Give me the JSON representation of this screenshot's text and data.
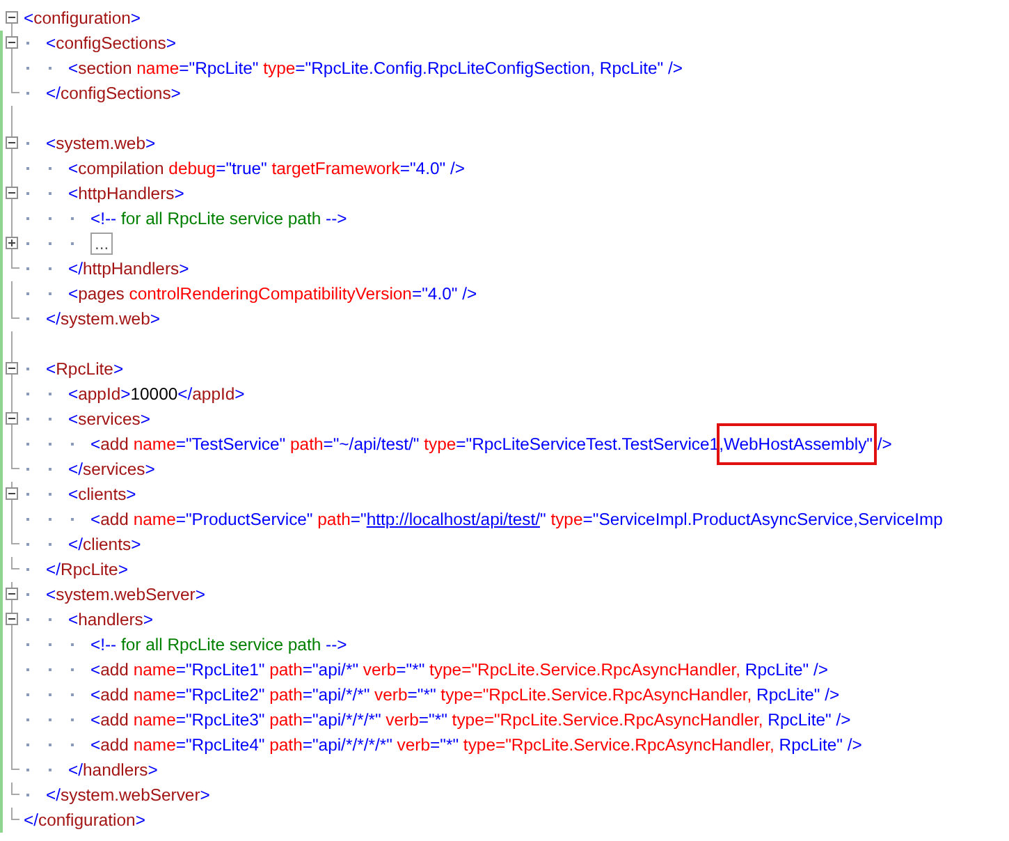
{
  "lines": [
    {
      "kind": "line",
      "expanded": true,
      "tokens": [
        {
          "kind": "d",
          "text": "<"
        },
        {
          "kind": "tag",
          "text": "configuration"
        },
        {
          "kind": "d",
          "text": ">"
        }
      ],
      "close": [
        {
          "kind": "d",
          "text": "</"
        },
        {
          "kind": "tag",
          "text": "configuration"
        },
        {
          "kind": "d",
          "text": ">"
        }
      ],
      "children": [
        {
          "kind": "line",
          "expanded": true,
          "tokens": [
            {
              "kind": "d",
              "text": "<"
            },
            {
              "kind": "tag",
              "text": "configSections"
            },
            {
              "kind": "d",
              "text": ">"
            }
          ],
          "close": [
            {
              "kind": "d",
              "text": "</"
            },
            {
              "kind": "tag",
              "text": "configSections"
            },
            {
              "kind": "d",
              "text": ">"
            }
          ],
          "children": [
            {
              "kind": "line",
              "tokens": [
                {
                  "kind": "d",
                  "text": "<"
                },
                {
                  "kind": "tag",
                  "text": "section"
                },
                {
                  "kind": "attr",
                  "text": " name"
                },
                {
                  "kind": "d",
                  "text": "="
                },
                {
                  "kind": "val",
                  "text": "\"RpcLite\""
                },
                {
                  "kind": "attr",
                  "text": " type"
                },
                {
                  "kind": "d",
                  "text": "="
                },
                {
                  "kind": "val",
                  "text": "\"RpcLite.Config.RpcLiteConfigSection, RpcLite\""
                },
                {
                  "kind": "d",
                  "text": " />"
                }
              ]
            }
          ]
        },
        {
          "kind": "blank"
        },
        {
          "kind": "line",
          "expanded": true,
          "tokens": [
            {
              "kind": "d",
              "text": "<"
            },
            {
              "kind": "tag",
              "text": "system.web"
            },
            {
              "kind": "d",
              "text": ">"
            }
          ],
          "close": [
            {
              "kind": "d",
              "text": "</"
            },
            {
              "kind": "tag",
              "text": "system.web"
            },
            {
              "kind": "d",
              "text": ">"
            }
          ],
          "children": [
            {
              "kind": "line",
              "tokens": [
                {
                  "kind": "d",
                  "text": "<"
                },
                {
                  "kind": "tag",
                  "text": "compilation"
                },
                {
                  "kind": "attr",
                  "text": " debug"
                },
                {
                  "kind": "d",
                  "text": "="
                },
                {
                  "kind": "val",
                  "text": "\"true\""
                },
                {
                  "kind": "attr",
                  "text": " targetFramework"
                },
                {
                  "kind": "d",
                  "text": "="
                },
                {
                  "kind": "val",
                  "text": "\"4.0\""
                },
                {
                  "kind": "d",
                  "text": " />"
                }
              ]
            },
            {
              "kind": "line",
              "expanded": true,
              "tokens": [
                {
                  "kind": "d",
                  "text": "<"
                },
                {
                  "kind": "tag",
                  "text": "httpHandlers"
                },
                {
                  "kind": "d",
                  "text": ">"
                }
              ],
              "close": [
                {
                  "kind": "d",
                  "text": "</"
                },
                {
                  "kind": "tag",
                  "text": "httpHandlers"
                },
                {
                  "kind": "d",
                  "text": ">"
                }
              ],
              "children": [
                {
                  "kind": "line",
                  "tokens": [
                    {
                      "kind": "d",
                      "text": "<!--"
                    },
                    {
                      "kind": "comment",
                      "text": " for all RpcLite service path "
                    },
                    {
                      "kind": "d",
                      "text": "-->"
                    }
                  ]
                },
                {
                  "kind": "collapsed",
                  "expanded": false,
                  "text": "..."
                }
              ]
            },
            {
              "kind": "line",
              "tokens": [
                {
                  "kind": "d",
                  "text": "<"
                },
                {
                  "kind": "tag",
                  "text": "pages"
                },
                {
                  "kind": "attr",
                  "text": " controlRenderingCompatibilityVersion"
                },
                {
                  "kind": "d",
                  "text": "="
                },
                {
                  "kind": "val",
                  "text": "\"4.0\""
                },
                {
                  "kind": "d",
                  "text": " />"
                }
              ]
            }
          ]
        },
        {
          "kind": "blank"
        },
        {
          "kind": "line",
          "expanded": true,
          "tokens": [
            {
              "kind": "d",
              "text": "<"
            },
            {
              "kind": "tag",
              "text": "RpcLite"
            },
            {
              "kind": "d",
              "text": ">"
            }
          ],
          "close": [
            {
              "kind": "d",
              "text": "</"
            },
            {
              "kind": "tag",
              "text": "RpcLite"
            },
            {
              "kind": "d",
              "text": ">"
            }
          ],
          "children": [
            {
              "kind": "line",
              "tokens": [
                {
                  "kind": "d",
                  "text": "<"
                },
                {
                  "kind": "tag",
                  "text": "appId"
                },
                {
                  "kind": "d",
                  "text": ">"
                },
                {
                  "kind": "text",
                  "text": "10000"
                },
                {
                  "kind": "d",
                  "text": "</"
                },
                {
                  "kind": "tag",
                  "text": "appId"
                },
                {
                  "kind": "d",
                  "text": ">"
                }
              ]
            },
            {
              "kind": "line",
              "expanded": true,
              "tokens": [
                {
                  "kind": "d",
                  "text": "<"
                },
                {
                  "kind": "tag",
                  "text": "services"
                },
                {
                  "kind": "d",
                  "text": ">"
                }
              ],
              "close": [
                {
                  "kind": "d",
                  "text": "</"
                },
                {
                  "kind": "tag",
                  "text": "services"
                },
                {
                  "kind": "d",
                  "text": ">"
                }
              ],
              "children": [
                {
                  "kind": "line",
                  "tokens": [
                    {
                      "kind": "d",
                      "text": "<"
                    },
                    {
                      "kind": "tag",
                      "text": "add"
                    },
                    {
                      "kind": "attr",
                      "text": " name"
                    },
                    {
                      "kind": "d",
                      "text": "="
                    },
                    {
                      "kind": "val",
                      "text": "\"TestService\""
                    },
                    {
                      "kind": "attr",
                      "text": " path"
                    },
                    {
                      "kind": "d",
                      "text": "="
                    },
                    {
                      "kind": "val",
                      "text": "\"~/api/test/\""
                    },
                    {
                      "kind": "attr",
                      "text": " type"
                    },
                    {
                      "kind": "d",
                      "text": "="
                    },
                    {
                      "kind": "val",
                      "text": "\"RpcLiteServiceTest.TestService1"
                    },
                    {
                      "kind": "val",
                      "text": ",WebHostAssembly\"",
                      "boxed": true
                    },
                    {
                      "kind": "d",
                      "text": " />"
                    }
                  ]
                }
              ]
            },
            {
              "kind": "line",
              "expanded": true,
              "tokens": [
                {
                  "kind": "d",
                  "text": "<"
                },
                {
                  "kind": "tag",
                  "text": "clients"
                },
                {
                  "kind": "d",
                  "text": ">"
                }
              ],
              "close": [
                {
                  "kind": "d",
                  "text": "</"
                },
                {
                  "kind": "tag",
                  "text": "clients"
                },
                {
                  "kind": "d",
                  "text": ">"
                }
              ],
              "children": [
                {
                  "kind": "line",
                  "tokens": [
                    {
                      "kind": "d",
                      "text": "<"
                    },
                    {
                      "kind": "tag",
                      "text": "add"
                    },
                    {
                      "kind": "attr",
                      "text": " name"
                    },
                    {
                      "kind": "d",
                      "text": "="
                    },
                    {
                      "kind": "val",
                      "text": "\"ProductService\""
                    },
                    {
                      "kind": "attr",
                      "text": " path"
                    },
                    {
                      "kind": "d",
                      "text": "="
                    },
                    {
                      "kind": "val",
                      "text": "\""
                    },
                    {
                      "kind": "link",
                      "text": "http://localhost/api/test/"
                    },
                    {
                      "kind": "val",
                      "text": "\""
                    },
                    {
                      "kind": "attr",
                      "text": " type"
                    },
                    {
                      "kind": "d",
                      "text": "="
                    },
                    {
                      "kind": "val",
                      "text": "\"ServiceImpl.ProductAsyncService,ServiceImp"
                    }
                  ]
                }
              ]
            }
          ]
        },
        {
          "kind": "line",
          "expanded": true,
          "tokens": [
            {
              "kind": "d",
              "text": "<"
            },
            {
              "kind": "tag",
              "text": "system.webServer"
            },
            {
              "kind": "d",
              "text": ">"
            }
          ],
          "close": [
            {
              "kind": "d",
              "text": "</"
            },
            {
              "kind": "tag",
              "text": "system.webServer"
            },
            {
              "kind": "d",
              "text": ">"
            }
          ],
          "children": [
            {
              "kind": "line",
              "expanded": true,
              "tokens": [
                {
                  "kind": "d",
                  "text": "<"
                },
                {
                  "kind": "tag",
                  "text": "handlers"
                },
                {
                  "kind": "d",
                  "text": ">"
                }
              ],
              "close": [
                {
                  "kind": "d",
                  "text": "</"
                },
                {
                  "kind": "tag",
                  "text": "handlers"
                },
                {
                  "kind": "d",
                  "text": ">"
                }
              ],
              "children": [
                {
                  "kind": "line",
                  "tokens": [
                    {
                      "kind": "d",
                      "text": "<!--"
                    },
                    {
                      "kind": "comment",
                      "text": " for all RpcLite service path "
                    },
                    {
                      "kind": "d",
                      "text": "-->"
                    }
                  ]
                },
                {
                  "kind": "line",
                  "tokens": [
                    {
                      "kind": "d",
                      "text": "<"
                    },
                    {
                      "kind": "tag",
                      "text": "add"
                    },
                    {
                      "kind": "attr",
                      "text": " name"
                    },
                    {
                      "kind": "d",
                      "text": "="
                    },
                    {
                      "kind": "val",
                      "text": "\"RpcLite1\""
                    },
                    {
                      "kind": "attr",
                      "text": " path"
                    },
                    {
                      "kind": "d",
                      "text": "="
                    },
                    {
                      "kind": "val",
                      "text": "\"api/*\""
                    },
                    {
                      "kind": "attr",
                      "text": " verb"
                    },
                    {
                      "kind": "d",
                      "text": "="
                    },
                    {
                      "kind": "val",
                      "text": "\"*\""
                    },
                    {
                      "kind": "attr",
                      "text": " type=\"RpcLite.Service.RpcAsyncHandler,"
                    },
                    {
                      "kind": "val",
                      "text": " RpcLite\""
                    },
                    {
                      "kind": "d",
                      "text": " />"
                    }
                  ]
                },
                {
                  "kind": "line",
                  "tokens": [
                    {
                      "kind": "d",
                      "text": "<"
                    },
                    {
                      "kind": "tag",
                      "text": "add"
                    },
                    {
                      "kind": "attr",
                      "text": " name"
                    },
                    {
                      "kind": "d",
                      "text": "="
                    },
                    {
                      "kind": "val",
                      "text": "\"RpcLite2\""
                    },
                    {
                      "kind": "attr",
                      "text": " path"
                    },
                    {
                      "kind": "d",
                      "text": "="
                    },
                    {
                      "kind": "val",
                      "text": "\"api/*/*\""
                    },
                    {
                      "kind": "attr",
                      "text": " verb"
                    },
                    {
                      "kind": "d",
                      "text": "="
                    },
                    {
                      "kind": "val",
                      "text": "\"*\""
                    },
                    {
                      "kind": "attr",
                      "text": " type=\"RpcLite.Service.RpcAsyncHandler,"
                    },
                    {
                      "kind": "val",
                      "text": " RpcLite\""
                    },
                    {
                      "kind": "d",
                      "text": " />"
                    }
                  ]
                },
                {
                  "kind": "line",
                  "tokens": [
                    {
                      "kind": "d",
                      "text": "<"
                    },
                    {
                      "kind": "tag",
                      "text": "add"
                    },
                    {
                      "kind": "attr",
                      "text": " name"
                    },
                    {
                      "kind": "d",
                      "text": "="
                    },
                    {
                      "kind": "val",
                      "text": "\"RpcLite3\""
                    },
                    {
                      "kind": "attr",
                      "text": " path"
                    },
                    {
                      "kind": "d",
                      "text": "="
                    },
                    {
                      "kind": "val",
                      "text": "\"api/*/*/*\""
                    },
                    {
                      "kind": "attr",
                      "text": " verb"
                    },
                    {
                      "kind": "d",
                      "text": "="
                    },
                    {
                      "kind": "val",
                      "text": "\"*\""
                    },
                    {
                      "kind": "attr",
                      "text": " type=\"RpcLite.Service.RpcAsyncHandler,"
                    },
                    {
                      "kind": "val",
                      "text": " RpcLite\""
                    },
                    {
                      "kind": "d",
                      "text": " />"
                    }
                  ]
                },
                {
                  "kind": "line",
                  "tokens": [
                    {
                      "kind": "d",
                      "text": "<"
                    },
                    {
                      "kind": "tag",
                      "text": "add"
                    },
                    {
                      "kind": "attr",
                      "text": " name"
                    },
                    {
                      "kind": "d",
                      "text": "="
                    },
                    {
                      "kind": "val",
                      "text": "\"RpcLite4\""
                    },
                    {
                      "kind": "attr",
                      "text": " path"
                    },
                    {
                      "kind": "d",
                      "text": "="
                    },
                    {
                      "kind": "val",
                      "text": "\"api/*/*/*/*\""
                    },
                    {
                      "kind": "attr",
                      "text": " verb"
                    },
                    {
                      "kind": "d",
                      "text": "="
                    },
                    {
                      "kind": "val",
                      "text": "\"*\""
                    },
                    {
                      "kind": "attr",
                      "text": " type=\"RpcLite.Service.RpcAsyncHandler,"
                    },
                    {
                      "kind": "val",
                      "text": " RpcLite\""
                    },
                    {
                      "kind": "d",
                      "text": " />"
                    }
                  ]
                }
              ]
            }
          ]
        }
      ]
    }
  ]
}
